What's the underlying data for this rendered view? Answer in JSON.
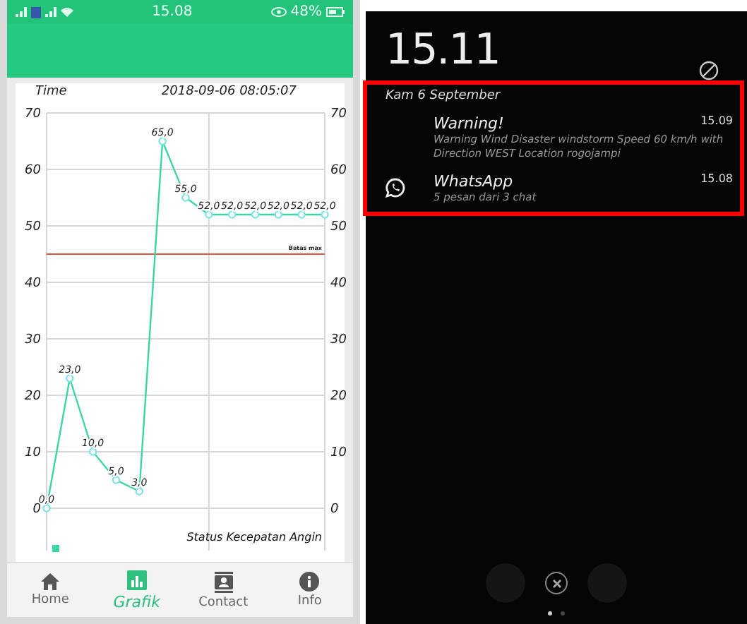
{
  "app_screen": {
    "status_bar": {
      "time": "15.08",
      "battery": "48%"
    },
    "chart": {
      "time_label": "Time",
      "caption": "Status Kecepatan Angin",
      "timestamp": "2018-09-06 08:05:07",
      "right_axis_labels": [
        "70",
        "60",
        "50",
        "40",
        "30",
        "20",
        "10",
        "0"
      ],
      "chart_data": {
        "type": "line",
        "ylim": [
          0,
          70
        ],
        "yticks": [
          0,
          10,
          20,
          30,
          40,
          50,
          60,
          70
        ],
        "grid": true,
        "series": [
          {
            "color": "#3dd6a3",
            "marker": "circle",
            "values": [
              0,
              23,
              10,
              5,
              3,
              65,
              55,
              52,
              52,
              52,
              52,
              52,
              52
            ]
          }
        ],
        "value_labels": [
          "0,0",
          "23,0",
          "10,0",
          "5,0",
          "3,0",
          "65,0",
          "55,0",
          "52,0",
          "52,0",
          "52,0",
          "52,0",
          "52,0",
          "52,0"
        ],
        "ref_lines": [
          {
            "axis": "y",
            "value": 45,
            "color": "#e05a4a",
            "label": "Batas max"
          }
        ]
      }
    },
    "nav": [
      {
        "label": "Home",
        "selected": false
      },
      {
        "label": "Grafik",
        "selected": true
      },
      {
        "label": "Contact",
        "selected": false
      },
      {
        "label": "Info",
        "selected": false
      }
    ]
  },
  "lock_screen": {
    "clock": "15.11",
    "date": "Kam 6 September",
    "notifications": [
      {
        "title": "Warning!",
        "time": "15.09",
        "body": "Warning Wind Disaster windstorm Speed 60 km/h with Direction WEST Location rogojampi",
        "kind": "plain"
      },
      {
        "title": "WhatsApp",
        "time": "15.08",
        "body": "5 pesan dari 3 chat",
        "kind": "chat"
      }
    ],
    "pager": [
      {
        "selected": true
      },
      {
        "selected": false
      }
    ]
  }
}
